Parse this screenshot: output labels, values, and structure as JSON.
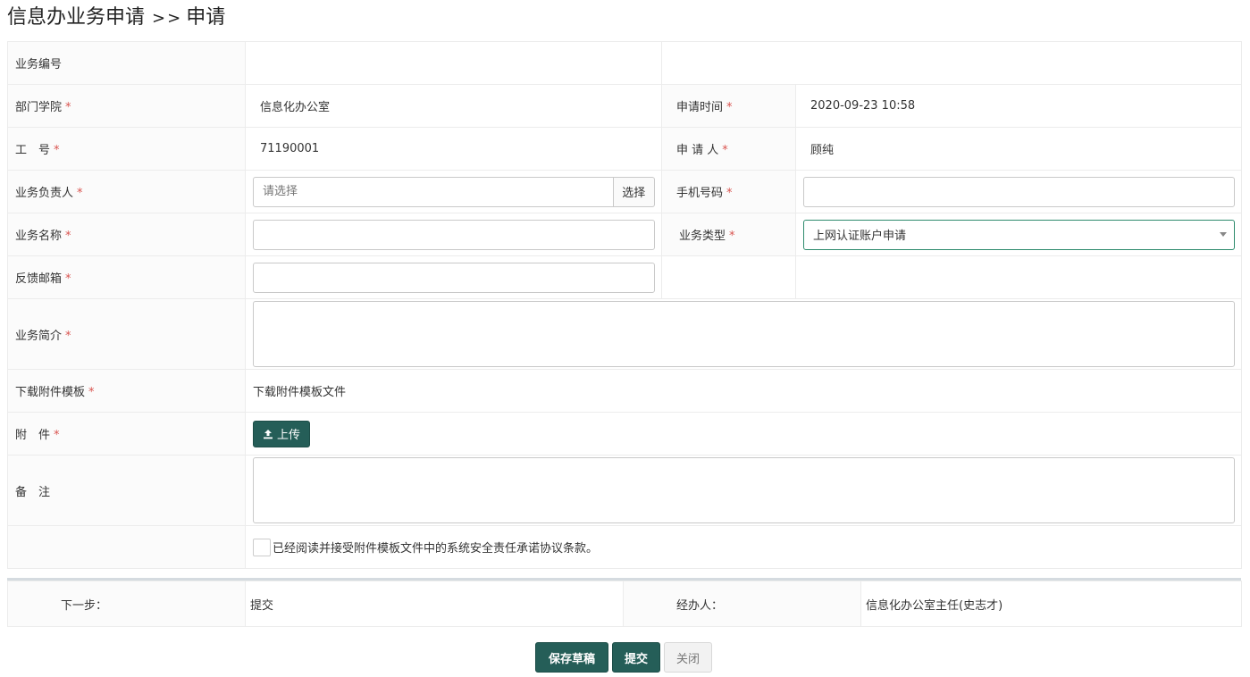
{
  "header": {
    "title": "信息办业务申请",
    "separator": ">>",
    "subtitle": "申请"
  },
  "form": {
    "row_business_no": {
      "label": "业务编号"
    },
    "dept": {
      "label": "部门学院",
      "value": "信息化办公室"
    },
    "apply_time": {
      "label": "申请时间",
      "value": "2020-09-23 10:58"
    },
    "work_no": {
      "label": "工　号",
      "value": "71190001"
    },
    "applicant": {
      "label": "申 请 人",
      "value": "顾纯"
    },
    "owner": {
      "label": "业务负责人",
      "placeholder": "请选择",
      "button": "选择"
    },
    "phone": {
      "label": "手机号码",
      "value": ""
    },
    "business_name": {
      "label": "业务名称",
      "value": ""
    },
    "business_type": {
      "label": "业务类型",
      "selected": "上网认证账户申请"
    },
    "email": {
      "label": "反馈邮箱",
      "value": ""
    },
    "intro": {
      "label": "业务简介"
    },
    "template": {
      "label": "下载附件模板",
      "link": "下载附件模板文件"
    },
    "attachment": {
      "label": "附　件",
      "button": "上传"
    },
    "remark": {
      "label": "备　注"
    },
    "agree": {
      "text": "已经阅读并接受附件模板文件中的系统安全责任承诺协议条款。"
    },
    "required_mark": "*"
  },
  "flow": {
    "next_label": "下一步：",
    "next_value": "提交",
    "handler_label": "经办人：",
    "handler_value": "信息化办公室主任(史志才)"
  },
  "actions": {
    "save": "保存草稿",
    "submit": "提交",
    "close": "关闭"
  },
  "colors": {
    "primary": "#255e58",
    "required": "#d9534f",
    "focus_border": "#2e8b6d"
  }
}
